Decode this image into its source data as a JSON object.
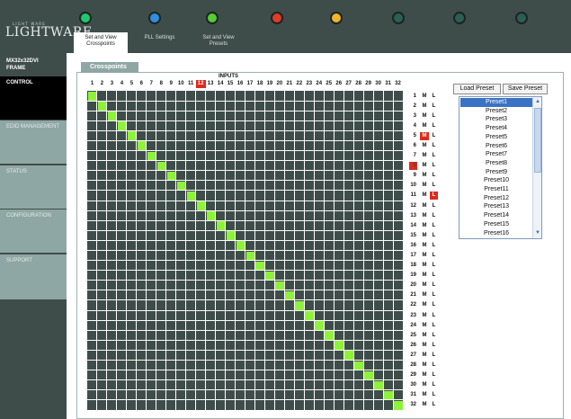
{
  "app": {
    "logo_small": "LIGHT WARE",
    "logo": "LIGHTWARE"
  },
  "status_leds": [
    "#1fc86a",
    "#2f8fe0",
    "#55cc33",
    "#e23b27",
    "#f0b42a",
    "#2a5f52",
    "#2a5f52",
    "#2a5f52"
  ],
  "tabs": [
    {
      "label": "Set and View\nCrosspoints",
      "active": true
    },
    {
      "label": "PLL Settings",
      "active": false
    },
    {
      "label": "Set and View\nPresets",
      "active": false
    }
  ],
  "sidebar": {
    "frame_label": "MX32x32DVI\nFRAME",
    "items": [
      {
        "label": "CONTROL",
        "active": true
      },
      {
        "label": "EDID MANAGEMENT",
        "active": false
      },
      {
        "label": "STATUS",
        "active": false
      },
      {
        "label": "CONFIGURATION",
        "active": false
      },
      {
        "label": "SUPPORT",
        "active": false
      }
    ]
  },
  "crosspoints": {
    "section_title": "Crosspoints",
    "inputs_label": "INPUTS",
    "inputs": [
      "1",
      "2",
      "3",
      "4",
      "5",
      "6",
      "7",
      "8",
      "9",
      "10",
      "11",
      "12",
      "13",
      "14",
      "15",
      "16",
      "17",
      "18",
      "19",
      "20",
      "21",
      "22",
      "23",
      "24",
      "25",
      "26",
      "27",
      "28",
      "29",
      "30",
      "31",
      "32"
    ],
    "outputs": [
      "1",
      "2",
      "3",
      "4",
      "5",
      "6",
      "7",
      "8",
      "9",
      "10",
      "11",
      "12",
      "13",
      "14",
      "15",
      "16",
      "17",
      "18",
      "19",
      "20",
      "21",
      "22",
      "23",
      "24",
      "25",
      "26",
      "27",
      "28",
      "29",
      "30",
      "31",
      "32"
    ],
    "mute_label": "M",
    "lock_label": "L",
    "muted_inputs": [
      12
    ],
    "muted_outputs": [
      5
    ],
    "locked_outputs": [
      11
    ],
    "marked_outputs": [
      8
    ],
    "connections": [
      1,
      2,
      3,
      4,
      5,
      6,
      7,
      8,
      9,
      10,
      11,
      12,
      13,
      14,
      15,
      16,
      17,
      18,
      19,
      20,
      21,
      22,
      23,
      24,
      25,
      26,
      27,
      28,
      29,
      30,
      31,
      32
    ]
  },
  "presets": {
    "load_label": "Load Preset",
    "save_label": "Save Preset",
    "items": [
      "Preset1",
      "Preset2",
      "Preset3",
      "Preset4",
      "Preset5",
      "Preset6",
      "Preset7",
      "Preset8",
      "Preset9",
      "Preset10",
      "Preset11",
      "Preset12",
      "Preset13",
      "Preset14",
      "Preset15",
      "Preset16"
    ],
    "selected_index": 0,
    "scroll_up": "▲",
    "scroll_down": "▼"
  },
  "colors": {
    "frame": "#3f4d4a",
    "accent_panel": "#8ea7a5",
    "connection": "#8ef23a",
    "alert": "#dd2a1d",
    "selection": "#3a72c4"
  }
}
